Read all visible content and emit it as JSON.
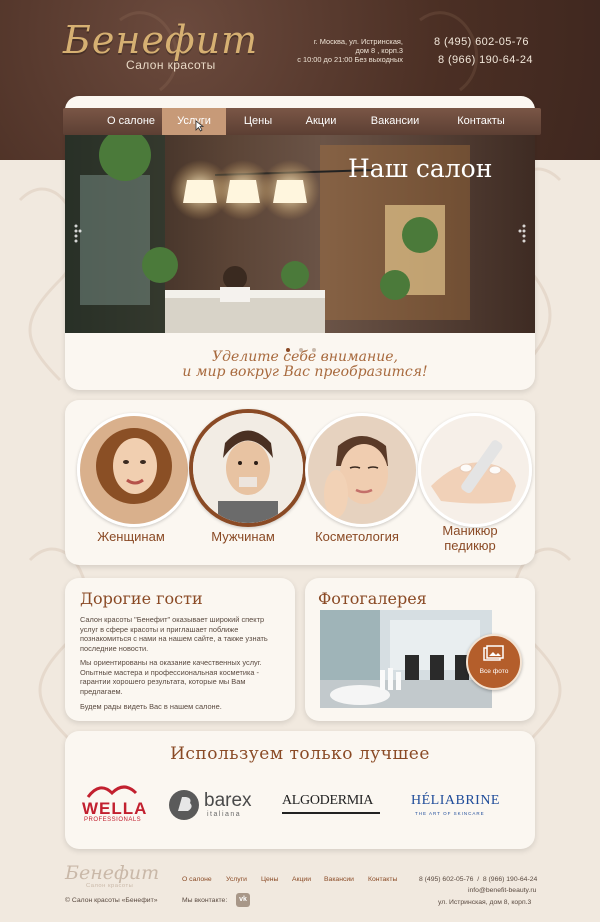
{
  "header": {
    "logo": "Бенефит",
    "logo_sub": "Салон красоты",
    "address_line1": "г. Москва, ул. Истринская,",
    "address_line2": "дом 8 , корп.3",
    "hours": "с 10:00 до 21:00 Без выходных",
    "phone1": "8 (495) 602-05-76",
    "phone2": "8 (966) 190-64-24"
  },
  "nav": [
    {
      "label": "О салоне"
    },
    {
      "label": "Услуги"
    },
    {
      "label": "Цены"
    },
    {
      "label": "Акции"
    },
    {
      "label": "Вакансии"
    },
    {
      "label": "Контакты"
    }
  ],
  "hero": {
    "title": "Наш салон",
    "slogan_line1": "Уделите себе внимание,",
    "slogan_line2": "и мир вокруг Вас преобразится!"
  },
  "categories": [
    {
      "label": "Женщинам"
    },
    {
      "label": "Мужчинам"
    },
    {
      "label": "Косметология"
    },
    {
      "label_line1": "Маникюр",
      "label_line2": "педикюр"
    }
  ],
  "guests": {
    "title": "Дорогие гости",
    "p1": "Салон красоты \"Бенефит\" оказывает широкий спектр услуг в сфере красоты и приглашает поближе познакомиться с нами на нашем сайте, а также узнать последние новости.",
    "p2": "Мы ориентированы на оказание качественных услуг. Опытные мастера и профессиональная косметика - гарантии хорошего результата, которые мы Вам предлагаем.",
    "p3": "Будем рады видеть Вас в нашем салоне."
  },
  "gallery": {
    "title": "Фотогалерея",
    "all_photos": "Все фото"
  },
  "brands": {
    "title": "Используем только лучшее",
    "wella": "WELLA",
    "wella_sub": "PROFESSIONALS",
    "barex": "barex",
    "barex_sub": "italiana",
    "algo": "ALGODERMIA",
    "helia": "HÉLIABRINE",
    "helia_sub": "THE ART OF SKINCARE"
  },
  "footer": {
    "logo": "Бенефит",
    "logo_sub": "Салон красоты",
    "links": [
      "О салоне",
      "Услуги",
      "Цены",
      "Акции",
      "Вакансии",
      "Контакты"
    ],
    "phones": "8 (495) 602-05-76  /  8 (966) 190-64-24",
    "email": "info@benefit-beauty.ru",
    "address": "ул. Истринская, дом 8, корп.3",
    "vk_label": "Мы вконтакте:",
    "copyright": "© Салон красоты «Бенефит»"
  },
  "colors": {
    "brown_dark": "#4b2f24",
    "accent": "#8a4a25",
    "nav_active": "#c79a78",
    "panel": "#fbf7f1"
  }
}
